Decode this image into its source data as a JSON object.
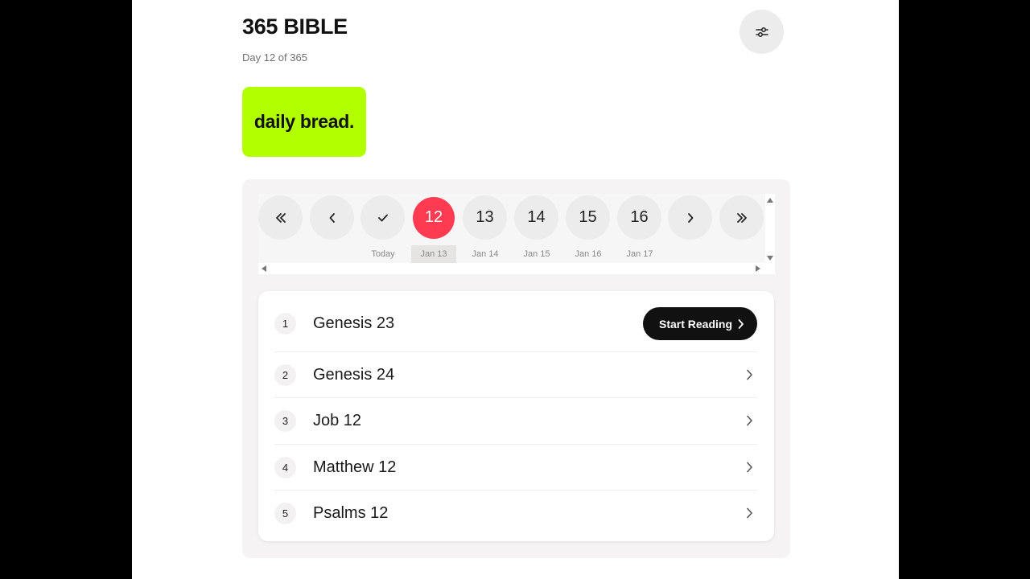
{
  "header": {
    "title": "365 BIBLE",
    "day_progress": "Day 12 of 365",
    "current_day": 12,
    "total_days": 365
  },
  "brand": {
    "label": "daily bread.",
    "color": "#b2ff00"
  },
  "day_nav": {
    "first_icon": "double-chevron-left-icon",
    "prev_icon": "chevron-left-icon",
    "today_icon": "check-icon",
    "next_icon": "chevron-right-icon",
    "last_icon": "double-chevron-right-icon",
    "days": [
      {
        "number": "12",
        "label": "Jan 13",
        "selected": true
      },
      {
        "number": "13",
        "label": "Jan 14"
      },
      {
        "number": "14",
        "label": "Jan 15"
      },
      {
        "number": "15",
        "label": "Jan 16"
      },
      {
        "number": "16",
        "label": "Jan 17"
      }
    ],
    "today_label": "Today",
    "accent_color": "#ff3b52"
  },
  "readings": [
    {
      "index": "1",
      "title": "Genesis 23",
      "action": "Start Reading"
    },
    {
      "index": "2",
      "title": "Genesis 24"
    },
    {
      "index": "3",
      "title": "Job 12"
    },
    {
      "index": "4",
      "title": "Matthew 12"
    },
    {
      "index": "5",
      "title": "Psalms 12"
    }
  ],
  "icons": {
    "settings": "sliders-icon",
    "row_arrow": "chevron-right-icon"
  }
}
